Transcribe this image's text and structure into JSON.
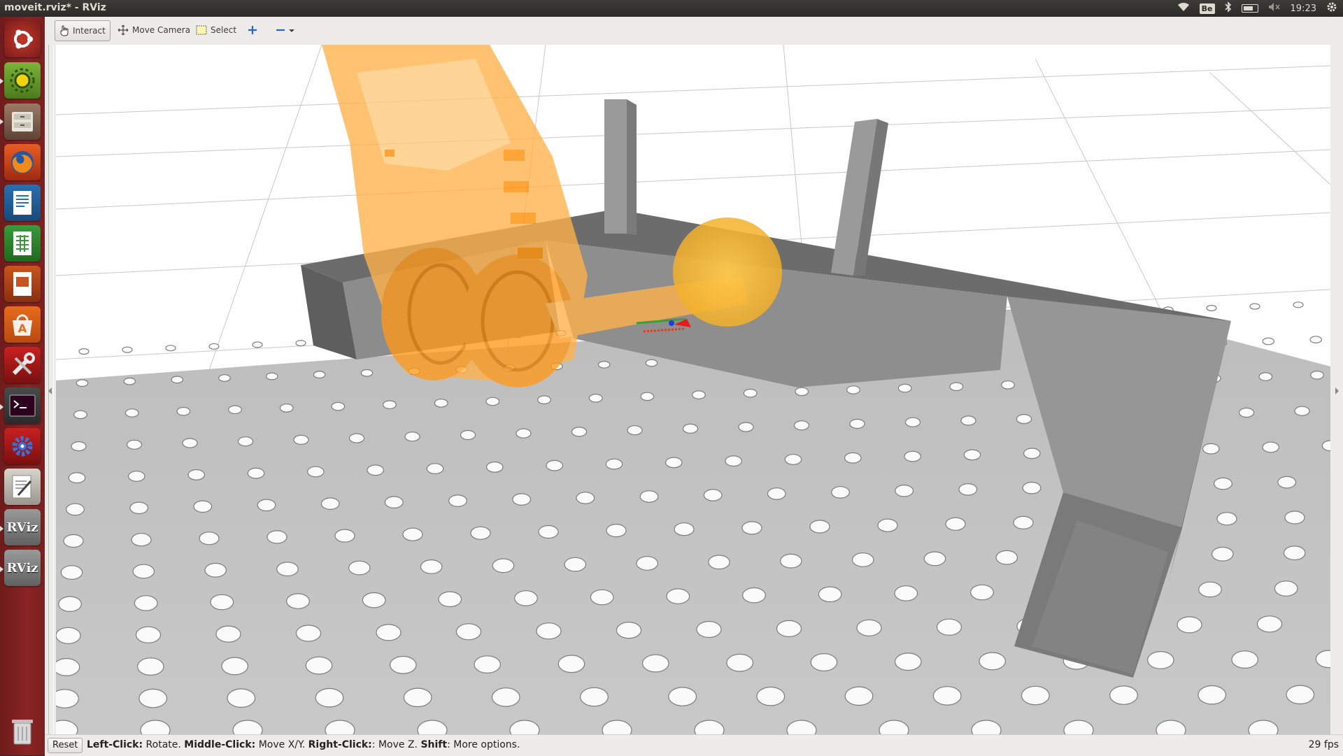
{
  "window_title": "moveit.rviz* - RViz",
  "tray": {
    "keyboard": "Be",
    "time": "19:23"
  },
  "launcher": {
    "items": [
      {
        "name": "ubuntu-dash",
        "running": false
      },
      {
        "name": "system-settings-app",
        "running": true
      },
      {
        "name": "files-app",
        "running": true
      },
      {
        "name": "firefox-app",
        "running": false
      },
      {
        "name": "writer-app",
        "running": false
      },
      {
        "name": "calc-app",
        "running": false
      },
      {
        "name": "impress-app",
        "running": false
      },
      {
        "name": "software-center-app",
        "running": false
      },
      {
        "name": "system-tools-app",
        "running": false
      },
      {
        "name": "terminal-app",
        "running": true
      },
      {
        "name": "settings-gear-app",
        "running": false
      },
      {
        "name": "text-editor-app",
        "running": false
      },
      {
        "name": "rviz-app-1",
        "running": true
      },
      {
        "name": "rviz-app-2",
        "running": true
      },
      {
        "name": "trash",
        "running": false
      }
    ],
    "rviz_label": "RViz"
  },
  "toolbar": {
    "interact": "Interact",
    "move_camera": "Move Camera",
    "select": "Select"
  },
  "status": {
    "reset": "Reset",
    "hint_left_key": "Left-Click:",
    "hint_left": " Rotate. ",
    "hint_middle_key": "Middle-Click:",
    "hint_middle": " Move X/Y. ",
    "hint_right_key": "Right-Click:",
    "hint_right": ": Move Z. ",
    "hint_shift_key": "Shift",
    "hint_shift": ": More options.",
    "fps": "29 fps"
  },
  "colors": {
    "launcher": "#7a2020",
    "robot": "#ff9a1a",
    "fixture": "#8a8a8a",
    "table": "#c4c4c4"
  }
}
